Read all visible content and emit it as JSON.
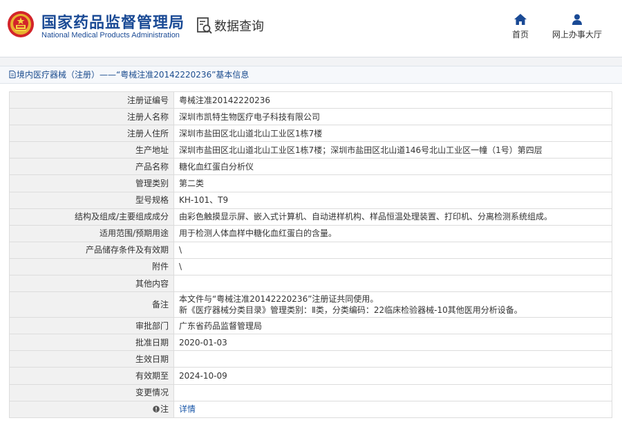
{
  "header": {
    "org_cn": "国家药品监督管理局",
    "org_en": "National Medical Products Administration",
    "search_label": "数据查询",
    "nav": [
      {
        "label": "首页",
        "icon": "home-icon"
      },
      {
        "label": "网上办事大厅",
        "icon": "user-icon"
      }
    ]
  },
  "breadcrumb": {
    "text": "境内医疗器械（注册）——“粤械注准20142220236”基本信息"
  },
  "record": {
    "rows": [
      {
        "label": "注册证编号",
        "value": "粤械注准20142220236"
      },
      {
        "label": "注册人名称",
        "value": "深圳市凯特生物医疗电子科技有限公司"
      },
      {
        "label": "注册人住所",
        "value": "深圳市盐田区北山道北山工业区1栋7楼"
      },
      {
        "label": "生产地址",
        "value": "深圳市盐田区北山道北山工业区1栋7楼；深圳市盐田区北山道146号北山工业区一幢（1号）第四层"
      },
      {
        "label": "产品名称",
        "value": "糖化血红蛋白分析仪"
      },
      {
        "label": "管理类别",
        "value": "第二类"
      },
      {
        "label": "型号规格",
        "value": "KH-101、T9"
      },
      {
        "label": "结构及组成/主要组成成分",
        "value": "由彩色触摸显示屏、嵌入式计算机、自动进样机构、样品恒温处理装置、打印机、分离检测系统组成。"
      },
      {
        "label": "适用范围/预期用途",
        "value": "用于检测人体血样中糖化血红蛋白的含量。"
      },
      {
        "label": "产品储存条件及有效期",
        "value": "\\"
      },
      {
        "label": "附件",
        "value": "\\"
      },
      {
        "label": "其他内容",
        "value": ""
      }
    ],
    "remark": {
      "label": "备注",
      "line1": "本文件与“粤械注准20142220236”注册证共同使用。",
      "line2": "新《医疗器械分类目录》管理类别：Ⅱ类，分类编码：22临床检验器械-10其他医用分析设备。"
    },
    "rows_after": [
      {
        "label": "审批部门",
        "value": "广东省药品监督管理局"
      },
      {
        "label": "批准日期",
        "value": "2020-01-03"
      },
      {
        "label": "生效日期",
        "value": ""
      },
      {
        "label": "有效期至",
        "value": "2024-10-09"
      },
      {
        "label": "变更情况",
        "value": ""
      }
    ],
    "note": {
      "label": "注",
      "link": "详情",
      "icon": "warning-icon"
    }
  },
  "colors": {
    "brand": "#1a4a95",
    "link": "#1a57a8",
    "label_bg": "#f1f1f1"
  }
}
